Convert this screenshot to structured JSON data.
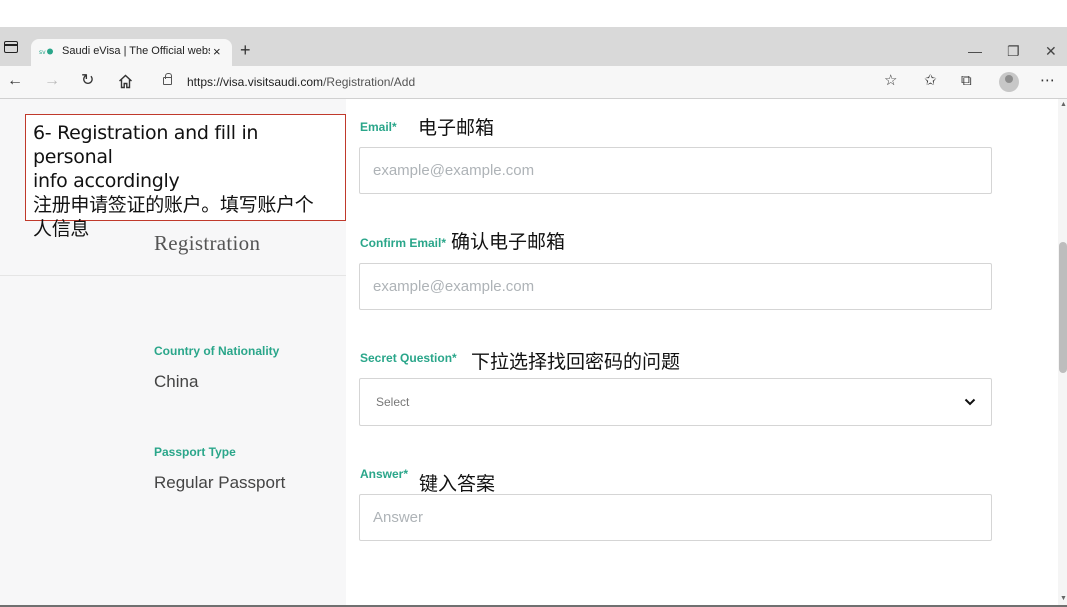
{
  "browser": {
    "tab_title": "Saudi eVisa | The Official website",
    "tab_close": "×",
    "new_tab": "+",
    "url_host": "https://visa.visitsaudi.com",
    "url_path": "/Registration/Add",
    "icons": [
      "tab-actions-icon",
      "favicon-icon",
      "back-icon",
      "forward-icon",
      "refresh-icon",
      "home-icon",
      "lock-icon",
      "add-favorite-icon",
      "favorites-icon",
      "collections-icon",
      "profile-icon",
      "more-icon"
    ]
  },
  "annotation": {
    "line1": "6- Registration and fill in personal",
    "line2": "info accordingly",
    "line3": "注册申请签证的账户。填写账户个",
    "line4": "人信息"
  },
  "left": {
    "title": "Registration",
    "nationality_label": "Country of Nationality",
    "nationality_value": "China",
    "passport_label": "Passport Type",
    "passport_value": "Regular Passport"
  },
  "form": {
    "email_label": "Email*",
    "email_note": "电子邮箱",
    "email_placeholder": "example@example.com",
    "confirm_label": "Confirm Email*",
    "confirm_note": "确认电子邮箱",
    "confirm_placeholder": "example@example.com",
    "secret_label": "Secret Question*",
    "secret_note": "下拉选择找回密码的问题",
    "secret_selected": "Select",
    "answer_label": "Answer*",
    "answer_note": "键入答案",
    "answer_placeholder": "Answer"
  },
  "colors": {
    "accent": "#2aa68a",
    "annotation_border": "#c0392b"
  }
}
